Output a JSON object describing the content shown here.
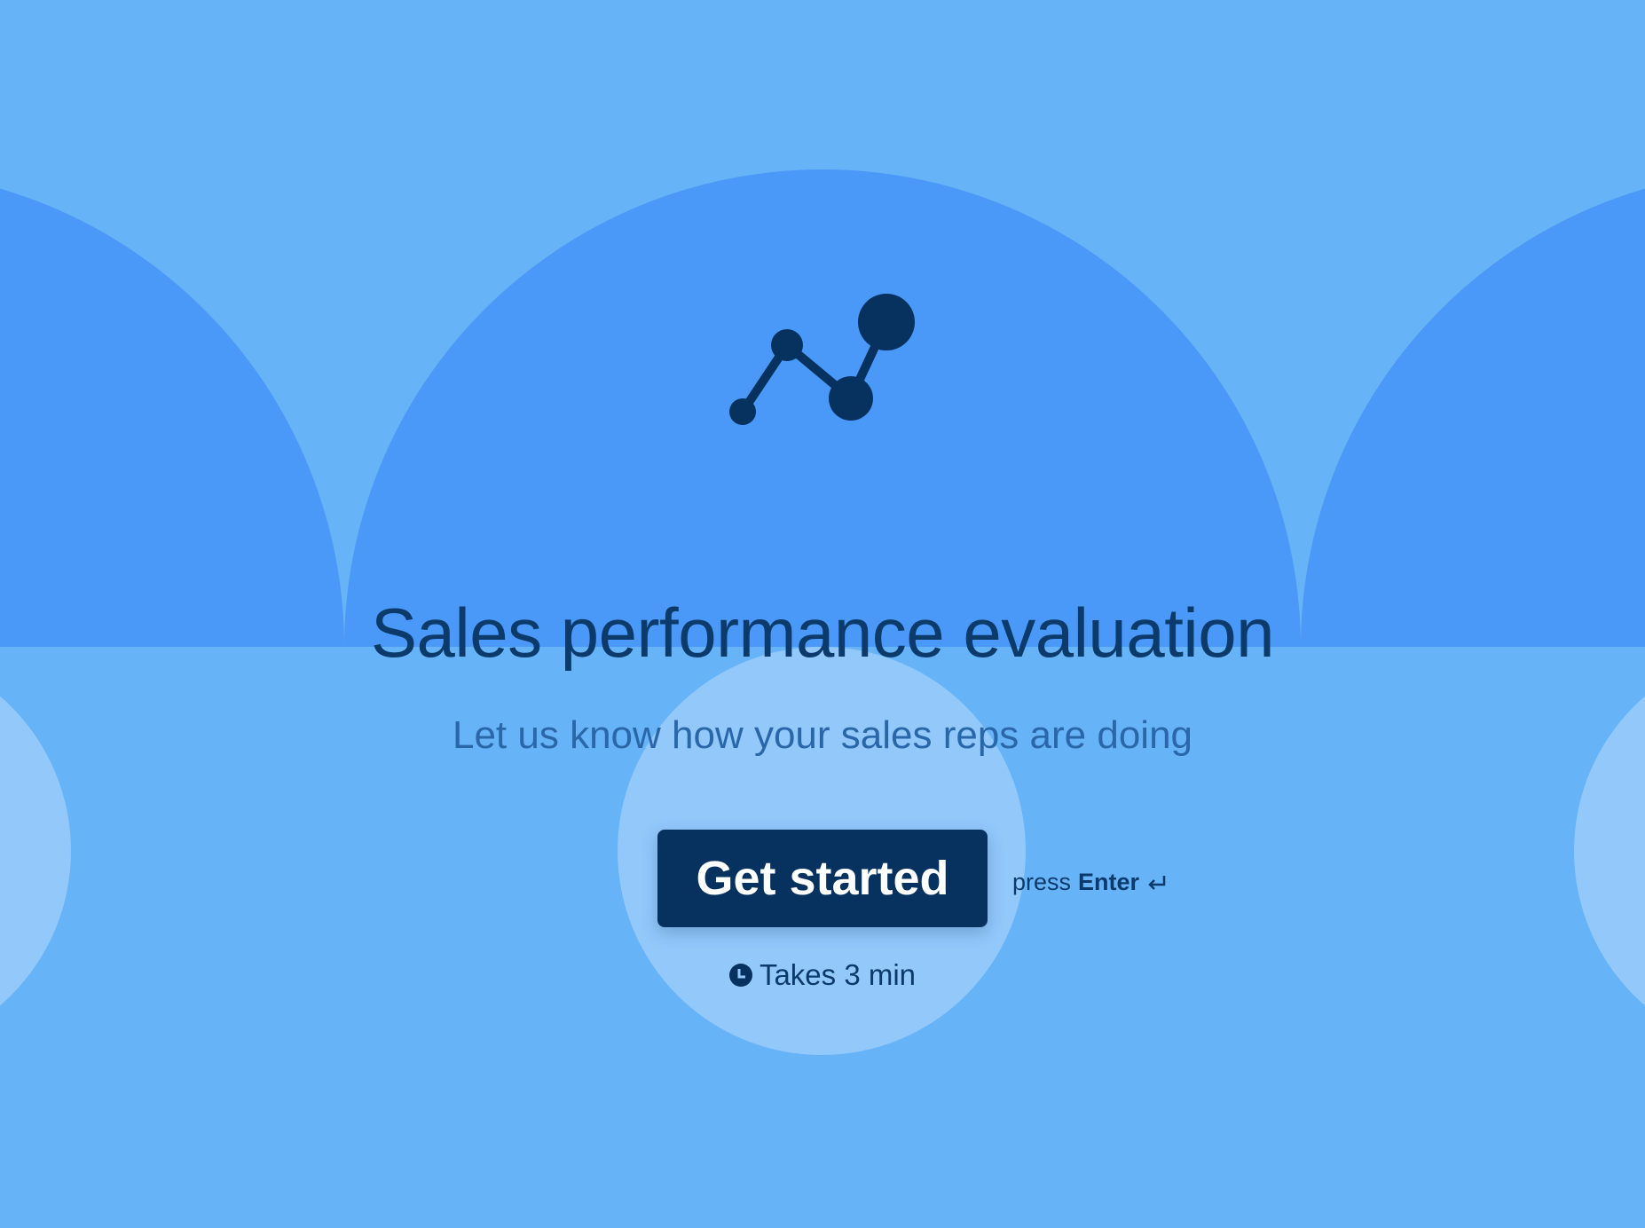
{
  "title": "Sales performance evaluation",
  "subtitle": "Let us know how your sales reps are doing",
  "cta": {
    "label": "Get started"
  },
  "hint": {
    "prefix": "press",
    "key": "Enter"
  },
  "duration": "Takes 3 min",
  "icons": {
    "logo": "trend-line-icon",
    "enter": "enter-return-icon",
    "clock": "clock-icon"
  },
  "colors": {
    "background": "#67b3f7",
    "dome": "#4a98f7",
    "accent": "#07325f",
    "light": "#93c8fb"
  }
}
